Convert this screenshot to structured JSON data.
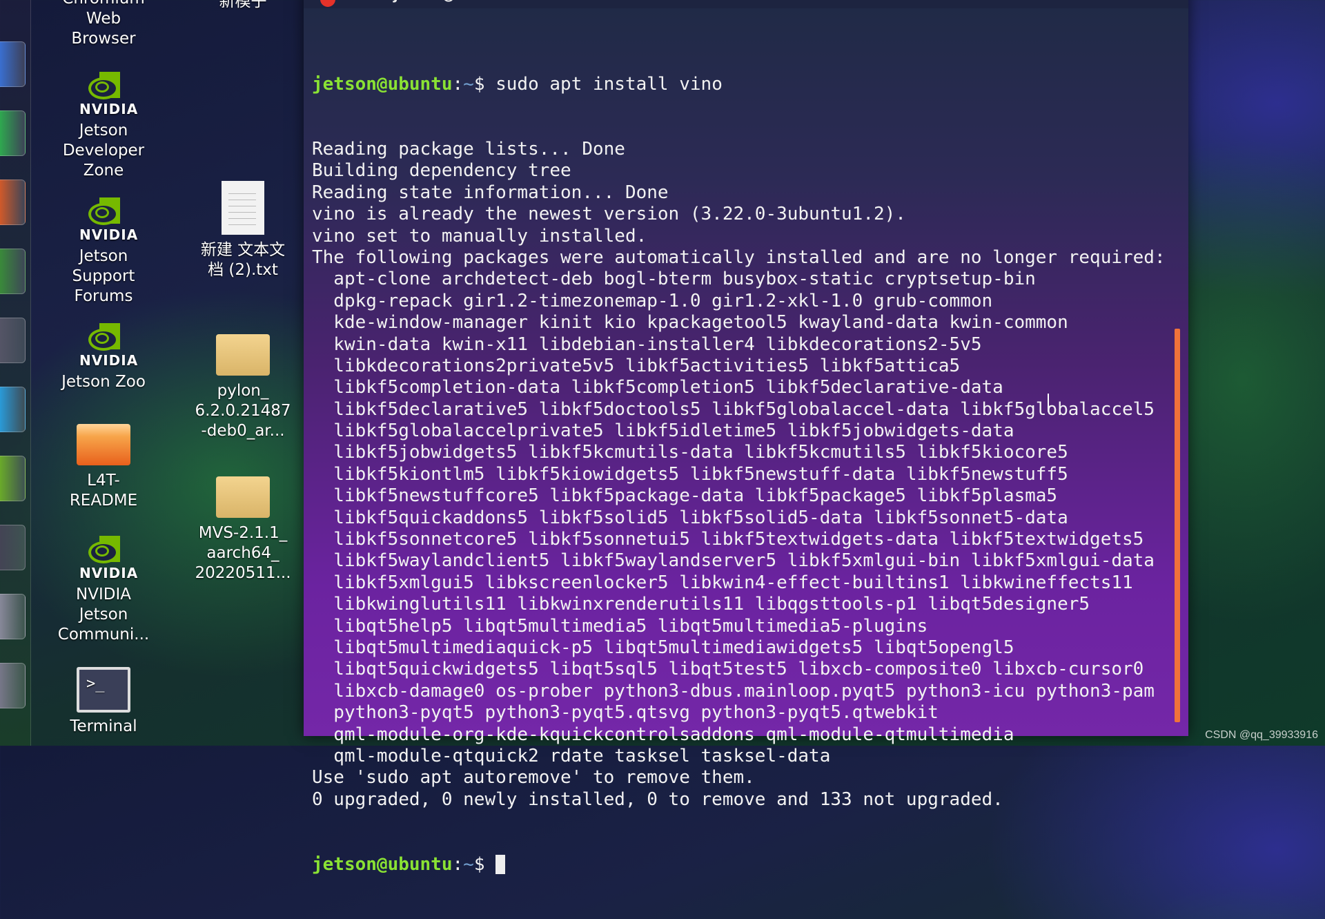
{
  "launcher": {
    "items": [
      {
        "name": "launcher-item-files",
        "color": "#3a6fd0"
      },
      {
        "name": "launcher-item-app-green",
        "color": "#2fa84f"
      },
      {
        "name": "launcher-item-libreoffice-impress",
        "color": "#d05a2a"
      },
      {
        "name": "launcher-item-libreoffice-calc",
        "color": "#3a8a3a"
      },
      {
        "name": "launcher-item-system-settings",
        "color": "#555566"
      },
      {
        "name": "launcher-item-software-center",
        "color": "#2a9ad8"
      },
      {
        "name": "launcher-item-software-updater",
        "color": "#6aaa2a"
      },
      {
        "name": "launcher-item-terminal",
        "color": "#444455"
      },
      {
        "name": "launcher-item-drive",
        "color": "#888899"
      },
      {
        "name": "launcher-item-trash",
        "color": "#777788"
      }
    ]
  },
  "desktop": {
    "icons_col1": [
      {
        "label": "Chromium\nWeb\nBrowser",
        "type": "app"
      },
      {
        "brand": "NVIDIA",
        "label": "Jetson\nDeveloper\nZone",
        "type": "nvidia"
      },
      {
        "brand": "NVIDIA",
        "label": "Jetson\nSupport\nForums",
        "type": "nvidia"
      },
      {
        "brand": "NVIDIA",
        "label": "Jetson Zoo",
        "type": "nvidia"
      },
      {
        "label": "L4T-\nREADME",
        "type": "folder-orange"
      },
      {
        "brand": "NVIDIA",
        "label": "NVIDIA\nJetson\nCommuni...",
        "type": "nvidia"
      },
      {
        "label": "Terminal",
        "type": "terminal"
      }
    ],
    "icons_col2": [
      {
        "label": "新模子",
        "type": "app"
      },
      {
        "label": "新建 文本文\n档 (2).txt",
        "type": "document"
      },
      {
        "label": "pylon_\n6.2.0.21487\n-deb0_ar...",
        "type": "package"
      },
      {
        "label": "MVS-2.1.1_\naarch64_\n20220511...",
        "type": "package"
      }
    ],
    "terminal_icon_glyph": ">_"
  },
  "terminal": {
    "title": "jetson@ubuntu: ~",
    "prompt_user": "jetson@ubuntu",
    "prompt_sep": ":",
    "prompt_path": "~",
    "prompt_symbol": "$",
    "command": " sudo apt install vino",
    "output": [
      "Reading package lists... Done",
      "Building dependency tree",
      "Reading state information... Done",
      "vino is already the newest version (3.22.0-3ubuntu1.2).",
      "vino set to manually installed.",
      "The following packages were automatically installed and are no longer required:",
      "  apt-clone archdetect-deb bogl-bterm busybox-static cryptsetup-bin",
      "  dpkg-repack gir1.2-timezonemap-1.0 gir1.2-xkl-1.0 grub-common",
      "  kde-window-manager kinit kio kpackagetool5 kwayland-data kwin-common",
      "  kwin-data kwin-x11 libdebian-installer4 libkdecorations2-5v5",
      "  libkdecorations2private5v5 libkf5activities5 libkf5attica5",
      "  libkf5completion-data libkf5completion5 libkf5declarative-data",
      "  libkf5declarative5 libkf5doctools5 libkf5globalaccel-data libkf5globalaccel5",
      "  libkf5globalaccelprivate5 libkf5idletime5 libkf5jobwidgets-data",
      "  libkf5jobwidgets5 libkf5kcmutils-data libkf5kcmutils5 libkf5kiocore5",
      "  libkf5kiontlm5 libkf5kiowidgets5 libkf5newstuff-data libkf5newstuff5",
      "  libkf5newstuffcore5 libkf5package-data libkf5package5 libkf5plasma5",
      "  libkf5quickaddons5 libkf5solid5 libkf5solid5-data libkf5sonnet5-data",
      "  libkf5sonnetcore5 libkf5sonnetui5 libkf5textwidgets-data libkf5textwidgets5",
      "  libkf5waylandclient5 libkf5waylandserver5 libkf5xmlgui-bin libkf5xmlgui-data",
      "  libkf5xmlgui5 libkscreenlocker5 libkwin4-effect-builtins1 libkwineffects11",
      "  libkwinglutils11 libkwinxrenderutils11 libqgsttools-p1 libqt5designer5",
      "  libqt5help5 libqt5multimedia5 libqt5multimedia5-plugins",
      "  libqt5multimediaquick-p5 libqt5multimediawidgets5 libqt5opengl5",
      "  libqt5quickwidgets5 libqt5sql5 libqt5test5 libxcb-composite0 libxcb-cursor0",
      "  libxcb-damage0 os-prober python3-dbus.mainloop.pyqt5 python3-icu python3-pam",
      "  python3-pyqt5 python3-pyqt5.qtsvg python3-pyqt5.qtwebkit",
      "  qml-module-org-kde-kquickcontrolsaddons qml-module-qtmultimedia",
      "  qml-module-qtquick2 rdate tasksel tasksel-data",
      "Use 'sudo apt autoremove' to remove them.",
      "0 upgraded, 0 newly installed, 0 to remove and 133 not upgraded."
    ],
    "colors": {
      "prompt_user": "#8ae234",
      "prompt_path": "#729fcf",
      "scrollbar": "#f0723a",
      "close_button": "#e5322a"
    }
  },
  "watermark": "CSDN @qq_39933916"
}
